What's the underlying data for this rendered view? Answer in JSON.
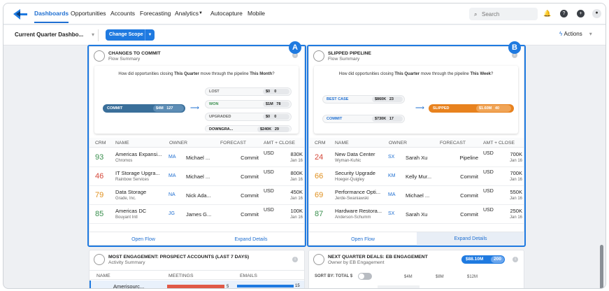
{
  "nav": {
    "items": [
      "Dashboards",
      "Opportunities",
      "Accounts",
      "Forecasting",
      "Analytics",
      "Autocapture",
      "Mobile"
    ],
    "search_placeholder": "Search"
  },
  "toolbar": {
    "quarter": "Current Quarter Dashbo...",
    "scope": "Change Scope",
    "actions": "Actions"
  },
  "badges": [
    "A",
    "B"
  ],
  "colors": {
    "accent": "#1f7ae0",
    "commit_pill": "#3a6f9a",
    "slipped_pill": "#e8821e"
  },
  "left_card": {
    "title": "CHANGES TO COMMIT",
    "subtitle": "Flow Summary",
    "question": {
      "pre": "How did opportunities closing ",
      "q": "This Quarter",
      "mid": " move through the pipeline ",
      "t": "This Month",
      "post": "?"
    },
    "source": {
      "label": "COMMIT",
      "value": "$4M",
      "count": "127"
    },
    "outcomes": [
      {
        "label": "LOST",
        "value": "$0",
        "count": "0"
      },
      {
        "label": "WON",
        "value": "$1M",
        "count": "78"
      },
      {
        "label": "UPGRADED",
        "value": "$0",
        "count": "0"
      },
      {
        "label": "DOWNGRA...",
        "value": "$240K",
        "count": "29"
      }
    ],
    "headers": [
      "CRM",
      "NAME",
      "OWNER",
      "FORECAST",
      "AMT + CLOSE"
    ],
    "rows": [
      {
        "crm": "93",
        "crm_color": "#3a8f4e",
        "name": "Americas Expansi...",
        "sub": "Chromos",
        "oi": "MA",
        "owner": "Michael ...",
        "fc": "Commit",
        "cur": "USD",
        "amt": "830K",
        "date": "Jan 16"
      },
      {
        "crm": "46",
        "crm_color": "#d5483a",
        "name": "IT Storage Upgra...",
        "sub": "Rainbow Services",
        "oi": "MA",
        "owner": "Michael ...",
        "fc": "Commit",
        "cur": "USD",
        "amt": "800K",
        "date": "Jan 16"
      },
      {
        "crm": "79",
        "crm_color": "#e0901e",
        "name": "Data Storage",
        "sub": "Grade, Inc.",
        "oi": "NA",
        "owner": "Nick Ada...",
        "fc": "Commit",
        "cur": "USD",
        "amt": "450K",
        "date": "Jan 16"
      },
      {
        "crm": "85",
        "crm_color": "#3a8f4e",
        "name": "Americas DC",
        "sub": "Bouyant Intl",
        "oi": "JG",
        "owner": "James G...",
        "fc": "Commit",
        "cur": "USD",
        "amt": "100K",
        "date": "Jan 16"
      }
    ],
    "footer": [
      "Open Flow",
      "Expand Details"
    ]
  },
  "right_card": {
    "title": "SLIPPED PIPELINE",
    "subtitle": "Flow Summary",
    "question": {
      "pre": "How did opportunities closing ",
      "q": "This Quarter",
      "mid": " move through the pipeline ",
      "t": "This Week",
      "post": "?"
    },
    "sources": [
      {
        "label": "BEST CASE",
        "value": "$860K",
        "count": "23"
      },
      {
        "label": "COMMIT",
        "value": "$730K",
        "count": "17"
      }
    ],
    "target": {
      "label": "SLIPPED",
      "value": "$1.60M",
      "count": "40"
    },
    "headers": [
      "CRM",
      "NAME",
      "OWNER",
      "FORECAST",
      "AMT + CLOSE"
    ],
    "rows": [
      {
        "crm": "24",
        "crm_color": "#d5483a",
        "name": "New Data Center",
        "sub": "Wyman-Kuhic",
        "oi": "SX",
        "owner": "Sarah Xu",
        "fc": "Pipeline",
        "cur": "USD",
        "amt": "700K",
        "date": "Jan 16"
      },
      {
        "crm": "66",
        "crm_color": "#e0901e",
        "name": "Security Upgrade",
        "sub": "Hoeger-Quigley",
        "oi": "KM",
        "owner": "Kelly Mur...",
        "fc": "Commit",
        "cur": "USD",
        "amt": "700K",
        "date": "Jan 16"
      },
      {
        "crm": "69",
        "crm_color": "#e0901e",
        "name": "Performance Opti...",
        "sub": "Jerde-Swaniawski",
        "oi": "MA",
        "owner": "Michael ...",
        "fc": "Commit",
        "cur": "USD",
        "amt": "550K",
        "date": "Jan 16"
      },
      {
        "crm": "87",
        "crm_color": "#3a8f4e",
        "name": "Hardware Restora...",
        "sub": "Anderson-Schumm",
        "oi": "SX",
        "owner": "Sarah Xu",
        "fc": "Commit",
        "cur": "USD",
        "amt": "250K",
        "date": "Jan 16"
      }
    ],
    "footer": [
      "Open Flow",
      "Expand Details"
    ]
  },
  "bottom_left": {
    "title": "MOST ENGAGEMENT: PROSPECT ACCOUNTS (LAST 7 DAYS)",
    "subtitle": "Activity Summary",
    "headers": [
      "NAME",
      "MEETINGS",
      "EMAILS"
    ],
    "first_row": {
      "name": "Amerisourc...",
      "meetings": "5",
      "emails": "15"
    }
  },
  "bottom_right": {
    "title": "NEXT QUARTER DEALS: EB ENGAGEMENT",
    "subtitle": "Owner by EB Engagement",
    "amount": "$88.10M",
    "count": "200",
    "sort": "SORT BY: TOTAL $",
    "ticks": [
      "$4M",
      "$8M",
      "$12M"
    ]
  }
}
